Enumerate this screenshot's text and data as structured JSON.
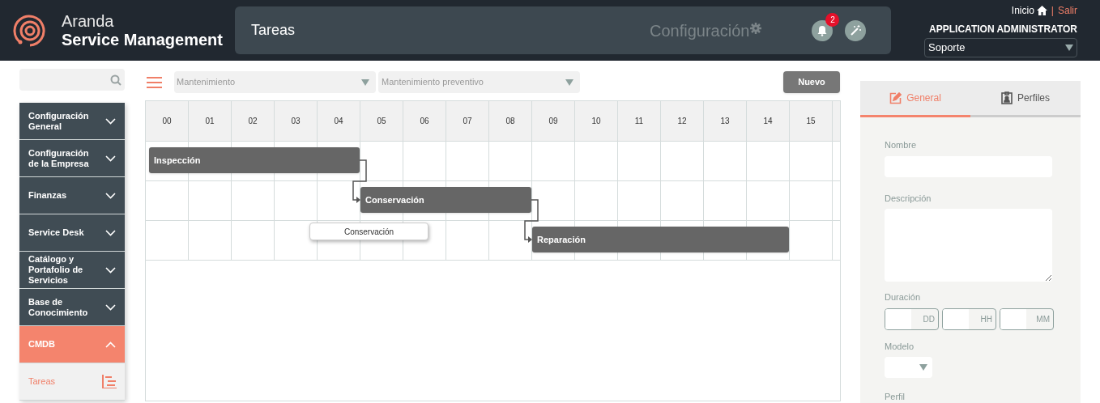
{
  "header": {
    "brand_top": "Aranda",
    "brand_bottom": "Service Management",
    "page_title": "Tareas",
    "section": "Configuración",
    "notifications": "2",
    "home_link": "Inicio",
    "separator": "|",
    "logout_link": "Salir",
    "user": "APPLICATION ADMINISTRATOR",
    "role_select": "Soporte"
  },
  "sidebar": {
    "items": [
      {
        "label": "Configuración General",
        "expanded": false
      },
      {
        "label": "Configuración de la Empresa",
        "expanded": false
      },
      {
        "label": "Finanzas",
        "expanded": false
      },
      {
        "label": "Service Desk",
        "expanded": false
      },
      {
        "label": "Catálogo y Portafolio de Servicios",
        "expanded": false
      },
      {
        "label": "Base de Conocimiento",
        "expanded": false
      },
      {
        "label": "CMDB",
        "expanded": true,
        "children": [
          {
            "label": "Tareas",
            "selected": true
          }
        ]
      }
    ]
  },
  "toolbar": {
    "filter_1": "Mantenimiento",
    "filter_2": "Mantenimiento preventivo",
    "new_button": "Nuevo"
  },
  "gantt": {
    "columns": [
      "00",
      "01",
      "02",
      "03",
      "04",
      "05",
      "06",
      "07",
      "08",
      "09",
      "10",
      "11",
      "12",
      "13",
      "14",
      "15"
    ],
    "tasks": [
      {
        "label": "Inspección"
      },
      {
        "label": "Conservación"
      },
      {
        "label": "Reparación"
      }
    ],
    "tooltip": "Conservación"
  },
  "form": {
    "tabs": [
      {
        "label": "General",
        "selected": true
      },
      {
        "label": "Perfiles",
        "selected": false
      }
    ],
    "name_label": "Nombre",
    "description_label": "Descripción",
    "duration_label": "Duración",
    "duration_units": [
      "DD",
      "HH",
      "MM"
    ],
    "model_label": "Modelo",
    "profile_label": "Perfil"
  }
}
